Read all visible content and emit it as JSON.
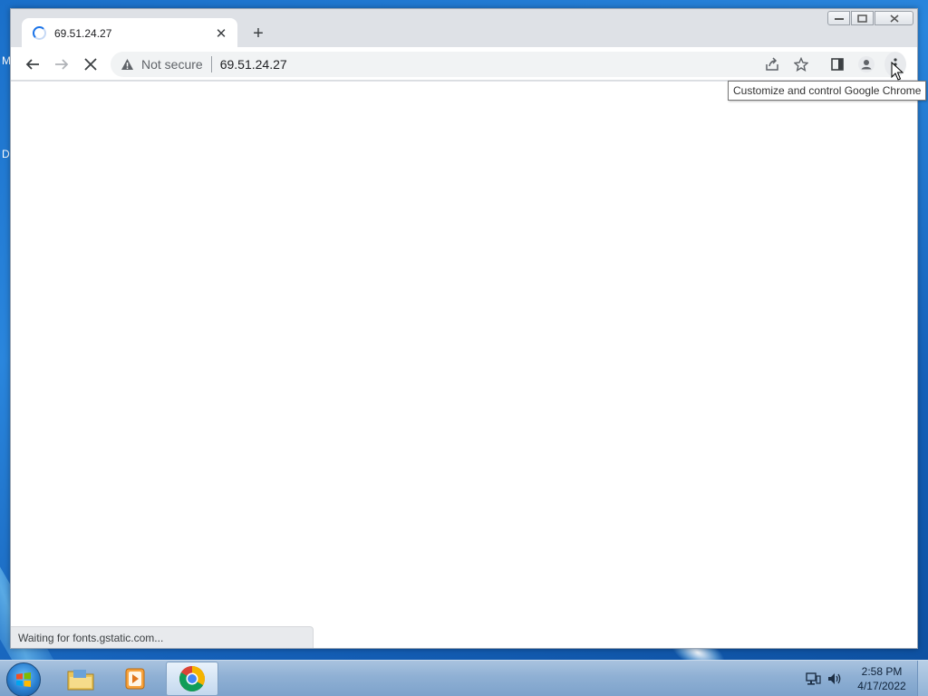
{
  "desktop": {
    "frag_top": "M",
    "frag_mid": "D"
  },
  "window": {
    "tab": {
      "title": "69.51.24.27",
      "close_glyph": "✕"
    },
    "newtab_glyph": "+",
    "omnibox": {
      "security_label": "Not secure",
      "url": "69.51.24.27"
    },
    "status_text": "Waiting for fonts.gstatic.com...",
    "tooltip": "Customize and control Google Chrome"
  },
  "taskbar": {
    "time": "2:58 PM",
    "date": "4/17/2022",
    "apps": [
      "Windows Explorer",
      "Windows Media Player",
      "Google Chrome"
    ]
  },
  "colors": {
    "accent": "#1a73e8",
    "toolbar_bg": "#ffffff",
    "tabstrip_bg": "#dee1e6"
  }
}
